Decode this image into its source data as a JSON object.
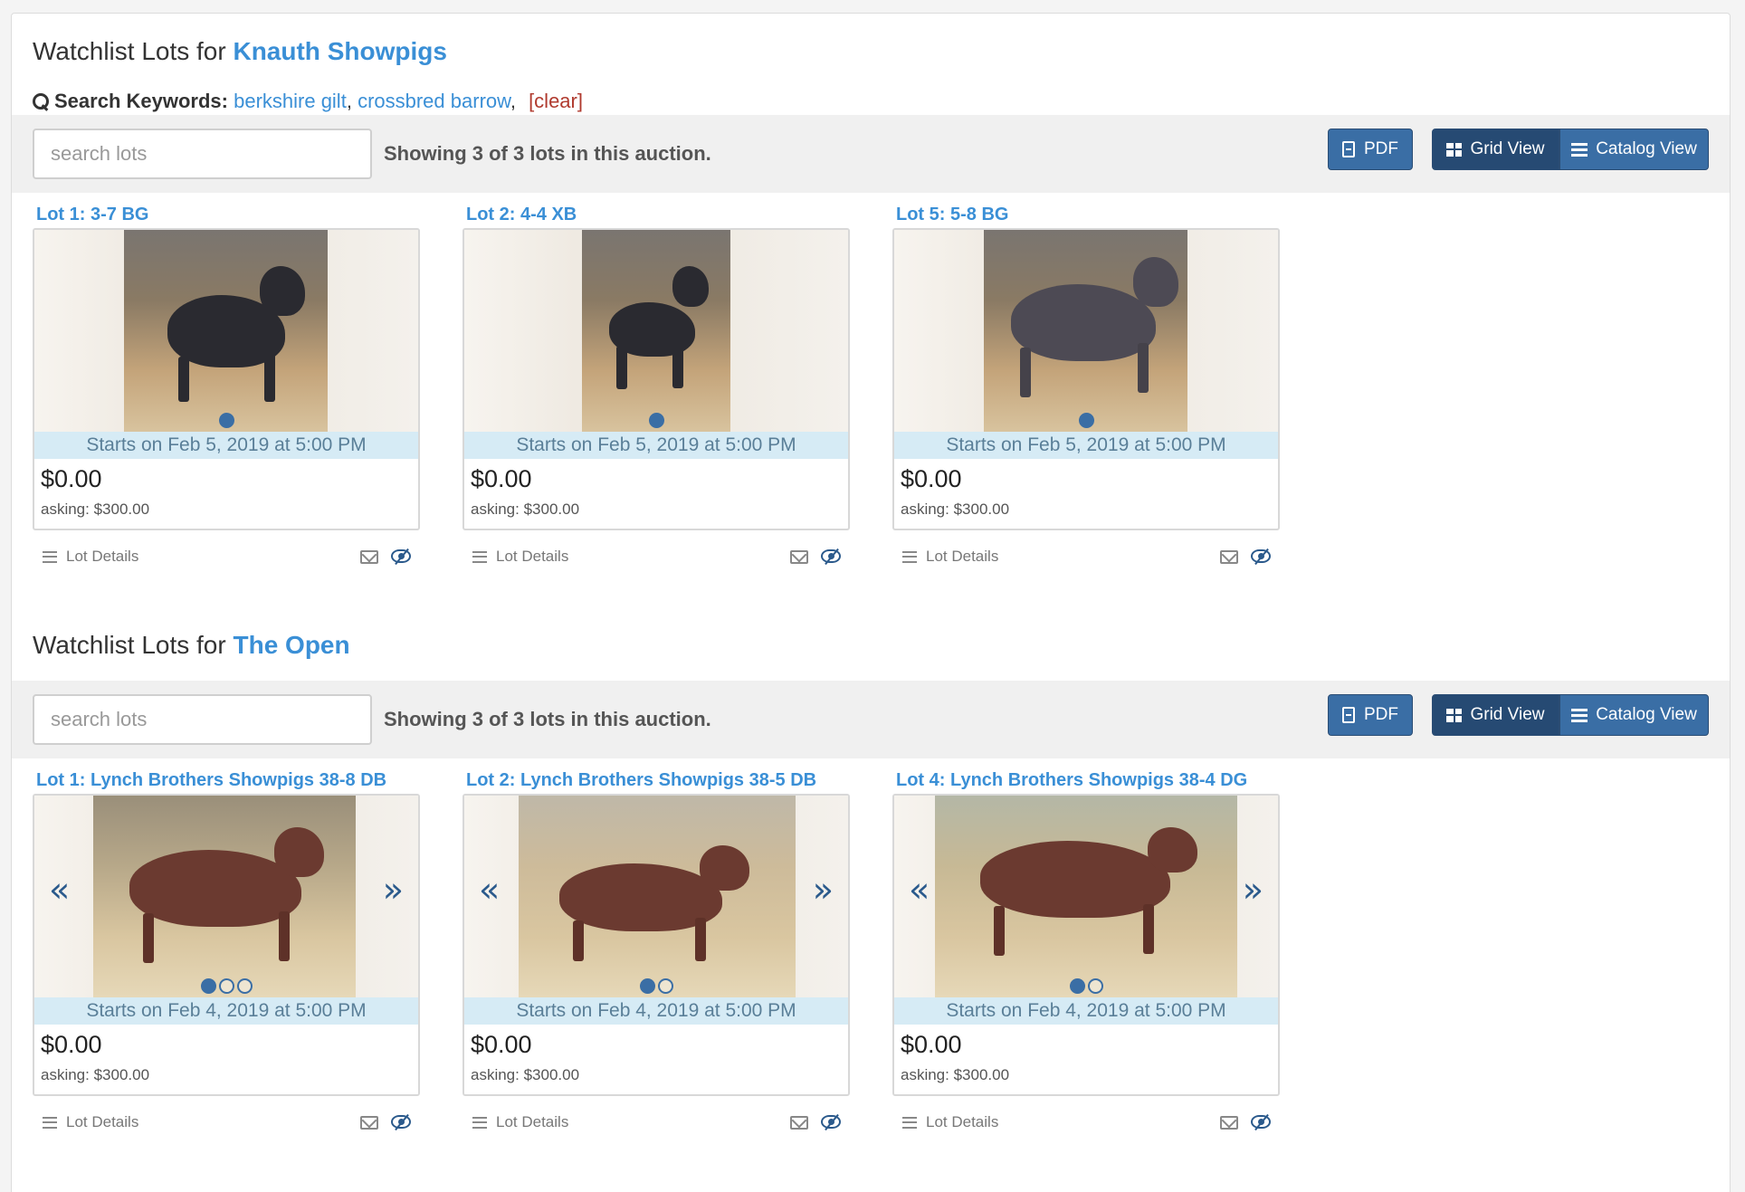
{
  "sections": [
    {
      "title_prefix": "Watchlist Lots for",
      "auction_name": "Knauth Showpigs",
      "keywords_label": "Search Keywords:",
      "keywords": [
        "berkshire gilt",
        "crossbred barrow"
      ],
      "clear_label": "[clear]",
      "search_placeholder": "search lots",
      "showing_text": "Showing 3 of 3 lots in this auction.",
      "pdf_label": "PDF",
      "grid_label": "Grid View",
      "catalog_label": "Catalog View",
      "lots": [
        {
          "title": "Lot 1: 3-7 BG",
          "starts": "Starts on Feb 5, 2019 at 5:00 PM",
          "price": "$0.00",
          "asking": "asking: $300.00",
          "details_label": "Lot Details"
        },
        {
          "title": "Lot 2: 4-4 XB",
          "starts": "Starts on Feb 5, 2019 at 5:00 PM",
          "price": "$0.00",
          "asking": "asking: $300.00",
          "details_label": "Lot Details"
        },
        {
          "title": "Lot 5: 5-8 BG",
          "starts": "Starts on Feb 5, 2019 at 5:00 PM",
          "price": "$0.00",
          "asking": "asking: $300.00",
          "details_label": "Lot Details"
        }
      ]
    },
    {
      "title_prefix": "Watchlist Lots for",
      "auction_name": "The Open",
      "search_placeholder": "search lots",
      "showing_text": "Showing 3 of 3 lots in this auction.",
      "pdf_label": "PDF",
      "grid_label": "Grid View",
      "catalog_label": "Catalog View",
      "lots": [
        {
          "title": "Lot 1: Lynch Brothers Showpigs 38-8 DB",
          "starts": "Starts on Feb 4, 2019 at 5:00 PM",
          "price": "$0.00",
          "asking": "asking: $300.00",
          "details_label": "Lot Details"
        },
        {
          "title": "Lot 2: Lynch Brothers Showpigs 38-5 DB",
          "starts": "Starts on Feb 4, 2019 at 5:00 PM",
          "price": "$0.00",
          "asking": "asking: $300.00",
          "details_label": "Lot Details"
        },
        {
          "title": "Lot 4: Lynch Brothers Showpigs 38-4 DG",
          "starts": "Starts on Feb 4, 2019 at 5:00 PM",
          "price": "$0.00",
          "asking": "asking: $300.00",
          "details_label": "Lot Details"
        }
      ]
    }
  ],
  "icons": {
    "search": "search-icon",
    "pdf": "file-pdf-icon",
    "grid": "grid-icon",
    "catalog": "list-icon",
    "menu": "menu-icon",
    "mail": "envelope-icon",
    "watch": "eye-slash-icon",
    "prev": "chevron-double-left-icon",
    "next": "chevron-double-right-icon"
  },
  "colors": {
    "link": "#3a8fd6",
    "button": "#3a6ea5",
    "button_active": "#264a73",
    "starts_bg": "#d6ebf5",
    "clear": "#b03a2e"
  }
}
